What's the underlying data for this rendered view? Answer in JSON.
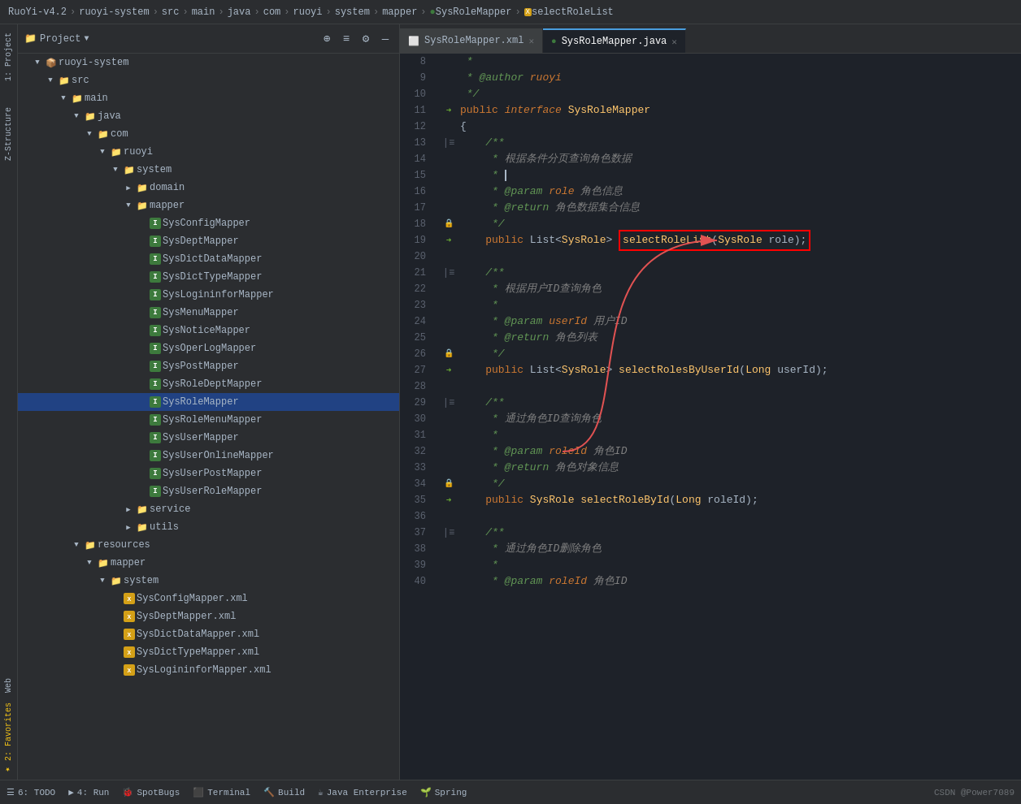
{
  "topbar": {
    "breadcrumb": [
      "RuoYi-v4.2",
      "ruoyi-system",
      "src",
      "main",
      "java",
      "com",
      "ruoyi",
      "system",
      "mapper",
      "SysRoleMapper",
      "selectRoleList"
    ]
  },
  "sidebar": {
    "title": "Project",
    "tree": [
      {
        "id": "ruoyi-system",
        "label": "ruoyi-system",
        "indent": 0,
        "type": "module",
        "open": true
      },
      {
        "id": "src",
        "label": "src",
        "indent": 1,
        "type": "folder",
        "open": true
      },
      {
        "id": "main",
        "label": "main",
        "indent": 2,
        "type": "folder",
        "open": true
      },
      {
        "id": "java",
        "label": "java",
        "indent": 3,
        "type": "folder",
        "open": true
      },
      {
        "id": "com",
        "label": "com",
        "indent": 4,
        "type": "folder",
        "open": true
      },
      {
        "id": "ruoyi",
        "label": "ruoyi",
        "indent": 5,
        "type": "folder",
        "open": true
      },
      {
        "id": "system",
        "label": "system",
        "indent": 6,
        "type": "folder",
        "open": true
      },
      {
        "id": "domain",
        "label": "domain",
        "indent": 7,
        "type": "folder",
        "open": false
      },
      {
        "id": "mapper",
        "label": "mapper",
        "indent": 7,
        "type": "folder",
        "open": true
      },
      {
        "id": "SysConfigMapper",
        "label": "SysConfigMapper",
        "indent": 8,
        "type": "interface"
      },
      {
        "id": "SysDeptMapper",
        "label": "SysDeptMapper",
        "indent": 8,
        "type": "interface"
      },
      {
        "id": "SysDictDataMapper",
        "label": "SysDictDataMapper",
        "indent": 8,
        "type": "interface"
      },
      {
        "id": "SysDictTypeMapper",
        "label": "SysDictTypeMapper",
        "indent": 8,
        "type": "interface"
      },
      {
        "id": "SysLogininforMapper",
        "label": "SysLogininforMapper",
        "indent": 8,
        "type": "interface"
      },
      {
        "id": "SysMenuMapper",
        "label": "SysMenuMapper",
        "indent": 8,
        "type": "interface"
      },
      {
        "id": "SysNoticeMapper",
        "label": "SysNoticeMapper",
        "indent": 8,
        "type": "interface"
      },
      {
        "id": "SysOperLogMapper",
        "label": "SysOperLogMapper",
        "indent": 8,
        "type": "interface"
      },
      {
        "id": "SysPostMapper",
        "label": "SysPostMapper",
        "indent": 8,
        "type": "interface"
      },
      {
        "id": "SysRoleDeptMapper",
        "label": "SysRoleDeptMapper",
        "indent": 8,
        "type": "interface"
      },
      {
        "id": "SysRoleMapper",
        "label": "SysRoleMapper",
        "indent": 8,
        "type": "interface",
        "selected": true
      },
      {
        "id": "SysRoleMenuMapper",
        "label": "SysRoleMenuMapper",
        "indent": 8,
        "type": "interface"
      },
      {
        "id": "SysUserMapper",
        "label": "SysUserMapper",
        "indent": 8,
        "type": "interface"
      },
      {
        "id": "SysUserOnlineMapper",
        "label": "SysUserOnlineMapper",
        "indent": 8,
        "type": "interface"
      },
      {
        "id": "SysUserPostMapper",
        "label": "SysUserPostMapper",
        "indent": 8,
        "type": "interface"
      },
      {
        "id": "SysUserRoleMapper",
        "label": "SysUserRoleMapper",
        "indent": 8,
        "type": "interface"
      },
      {
        "id": "service",
        "label": "service",
        "indent": 7,
        "type": "folder",
        "open": false
      },
      {
        "id": "utils",
        "label": "utils",
        "indent": 7,
        "type": "folder",
        "open": false
      },
      {
        "id": "resources",
        "label": "resources",
        "indent": 3,
        "type": "folder",
        "open": true
      },
      {
        "id": "mapper-res",
        "label": "mapper",
        "indent": 4,
        "type": "folder",
        "open": true
      },
      {
        "id": "system-res",
        "label": "system",
        "indent": 5,
        "type": "folder",
        "open": true
      },
      {
        "id": "SysConfigMapper.xml",
        "label": "SysConfigMapper.xml",
        "indent": 6,
        "type": "xml"
      },
      {
        "id": "SysDeptMapper.xml",
        "label": "SysDeptMapper.xml",
        "indent": 6,
        "type": "xml"
      },
      {
        "id": "SysDictDataMapper.xml",
        "label": "SysDictDataMapper.xml",
        "indent": 6,
        "type": "xml"
      },
      {
        "id": "SysDictTypeMapper.xml",
        "label": "SysDictTypeMapper.xml",
        "indent": 6,
        "type": "xml"
      },
      {
        "id": "SysLogininforMapper.xml",
        "label": "SysLogininforMapper.xml",
        "indent": 6,
        "type": "xml"
      }
    ]
  },
  "tabs": [
    {
      "id": "xml",
      "label": "SysRoleMapper.xml",
      "type": "xml",
      "active": false
    },
    {
      "id": "java",
      "label": "SysRoleMapper.java",
      "type": "java",
      "active": true
    }
  ],
  "code": {
    "lines": [
      {
        "num": 8,
        "gutter": "",
        "content": " * "
      },
      {
        "num": 9,
        "gutter": "",
        "content": " * @author ruoyi"
      },
      {
        "num": 10,
        "gutter": "",
        "content": " */"
      },
      {
        "num": 11,
        "gutter": "arrow",
        "content": "public interface SysRoleMapper"
      },
      {
        "num": 12,
        "gutter": "",
        "content": "{"
      },
      {
        "num": 13,
        "gutter": "fold",
        "content": "    /**"
      },
      {
        "num": 14,
        "gutter": "",
        "content": "     * 根据条件分页查询角色数据"
      },
      {
        "num": 15,
        "gutter": "",
        "content": "     * "
      },
      {
        "num": 16,
        "gutter": "",
        "content": "     * @param role 角色信息"
      },
      {
        "num": 17,
        "gutter": "",
        "content": "     * @return 角色数据集合信息"
      },
      {
        "num": 18,
        "gutter": "lock",
        "content": "     */"
      },
      {
        "num": 19,
        "gutter": "arrow",
        "content": "    public List<SysRole> selectRoleList(SysRole role);"
      },
      {
        "num": 20,
        "gutter": "",
        "content": ""
      },
      {
        "num": 21,
        "gutter": "fold",
        "content": "    /**"
      },
      {
        "num": 22,
        "gutter": "",
        "content": "     * 根据用户ID查询角色"
      },
      {
        "num": 23,
        "gutter": "",
        "content": "     * "
      },
      {
        "num": 24,
        "gutter": "",
        "content": "     * @param userId 用户ID"
      },
      {
        "num": 25,
        "gutter": "",
        "content": "     * @return 角色列表"
      },
      {
        "num": 26,
        "gutter": "lock",
        "content": "     */"
      },
      {
        "num": 27,
        "gutter": "arrow",
        "content": "    public List<SysRole> selectRolesByUserId(Long userId);"
      },
      {
        "num": 28,
        "gutter": "",
        "content": ""
      },
      {
        "num": 29,
        "gutter": "fold",
        "content": "    /**"
      },
      {
        "num": 30,
        "gutter": "",
        "content": "     * 通过角色ID查询角色"
      },
      {
        "num": 31,
        "gutter": "",
        "content": "     * "
      },
      {
        "num": 32,
        "gutter": "",
        "content": "     * @param roleId 角色ID"
      },
      {
        "num": 33,
        "gutter": "",
        "content": "     * @return 角色对象信息"
      },
      {
        "num": 34,
        "gutter": "lock",
        "content": "     */"
      },
      {
        "num": 35,
        "gutter": "arrow",
        "content": "    public SysRole selectRoleById(Long roleId);"
      },
      {
        "num": 36,
        "gutter": "",
        "content": ""
      },
      {
        "num": 37,
        "gutter": "fold",
        "content": "    /**"
      },
      {
        "num": 38,
        "gutter": "",
        "content": "     * 通过角色ID删除角色"
      },
      {
        "num": 39,
        "gutter": "",
        "content": "     * "
      },
      {
        "num": 40,
        "gutter": "",
        "content": "     * @param roleId 角色ID"
      }
    ]
  },
  "bottombar": {
    "items": [
      "6: TODO",
      "4: Run",
      "SpotBugs",
      "Terminal",
      "Build",
      "Java Enterprise",
      "Spring"
    ],
    "right": "CSDN @Power7089"
  }
}
